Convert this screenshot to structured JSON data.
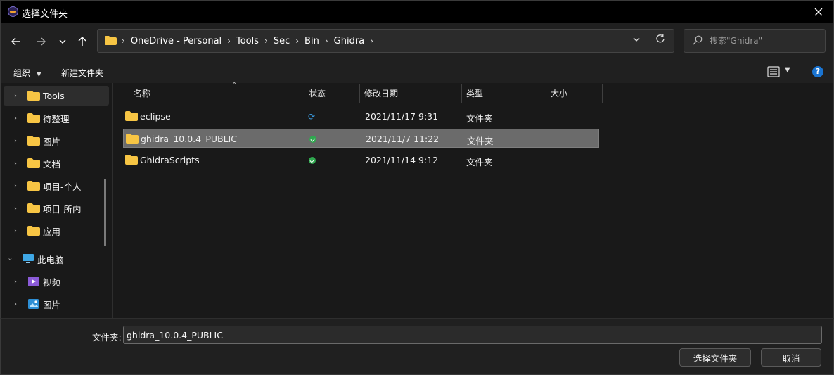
{
  "window": {
    "title": "选择文件夹"
  },
  "nav": {
    "breadcrumb": [
      "OneDrive - Personal",
      "Tools",
      "Sec",
      "Bin",
      "Ghidra"
    ],
    "search_placeholder": "搜索\"Ghidra\""
  },
  "toolbar": {
    "organize_label": "组织",
    "new_folder_label": "新建文件夹"
  },
  "sidebar": {
    "items": [
      {
        "label": "Tools",
        "icon": "folder-icon",
        "active": true
      },
      {
        "label": "待整理",
        "icon": "folder-icon"
      },
      {
        "label": "图片",
        "icon": "folder-icon"
      },
      {
        "label": "文档",
        "icon": "folder-icon"
      },
      {
        "label": "项目-个人",
        "icon": "folder-icon"
      },
      {
        "label": "项目-所内",
        "icon": "folder-icon"
      },
      {
        "label": "应用",
        "icon": "folder-icon"
      }
    ],
    "pc": {
      "label": "此电脑",
      "icon": "computer-icon"
    },
    "pc_items": [
      {
        "label": "视频",
        "icon": "video-icon"
      },
      {
        "label": "图片",
        "icon": "pictures-icon"
      }
    ]
  },
  "table": {
    "columns": [
      "名称",
      "状态",
      "修改日期",
      "类型",
      "大小"
    ],
    "rows": [
      {
        "name": "eclipse",
        "status": "sync-icon",
        "date": "2021/11/17 9:31",
        "type": "文件夹",
        "selected": false
      },
      {
        "name": "ghidra_10.0.4_PUBLIC",
        "status": "available-icon",
        "date": "2021/11/7 11:22",
        "type": "文件夹",
        "selected": true
      },
      {
        "name": "GhidraScripts",
        "status": "available-icon",
        "date": "2021/11/14 9:12",
        "type": "文件夹",
        "selected": false
      }
    ]
  },
  "footer": {
    "folder_label": "文件夹:",
    "folder_value": "ghidra_10.0.4_PUBLIC",
    "select_button": "选择文件夹",
    "cancel_button": "取消"
  },
  "colors": {
    "folder": "#f7c544",
    "selection": "#6b6b6b",
    "accent": "#1a74d1"
  }
}
